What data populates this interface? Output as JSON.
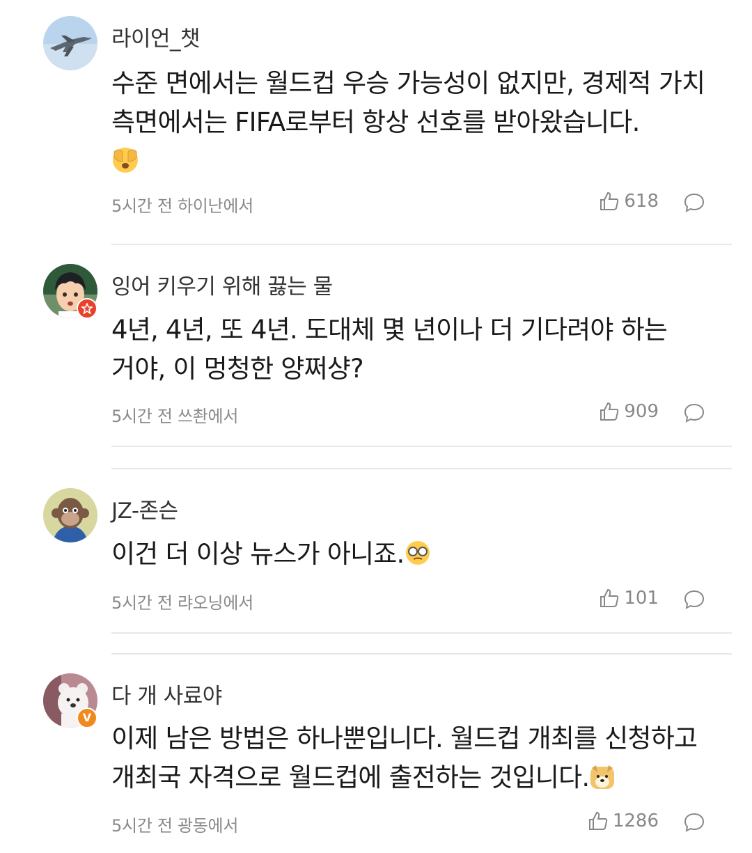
{
  "comments": [
    {
      "username": "라이언_챗",
      "text": "수준 면에서는 월드컵 우승 가능성이 없지만, 경제적 가치 측면에서는 FIFA로부터 항상 선호를 받아왔습니다.",
      "emoji": "face-with-hands-emoji",
      "time": "5시간 전",
      "location": "하이난에서",
      "likes": "618",
      "avatar": "fighter-jet-avatar",
      "badge": null
    },
    {
      "username": "잉어 키우기 위해 끓는 물",
      "text": "4년, 4년, 또 4년. 도대체 몇 년이나 더 기다려야 하는 거야, 이 멍청한 양쩌샹?",
      "emoji": null,
      "time": "5시간 전",
      "location": "쓰촨에서",
      "likes": "909",
      "avatar": "anime-boy-avatar",
      "badge": "red-star-badge"
    },
    {
      "username": "JZ-존슨",
      "text": "이건 더 이상 뉴스가 아니죠.",
      "emoji": "glasses-face-emoji",
      "time": "5시간 전",
      "location": "랴오닝에서",
      "likes": "101",
      "avatar": "ape-avatar",
      "badge": null
    },
    {
      "username": "다 개 사료야",
      "text": "이제 남은 방법은 하나뿐입니다. 월드컵 개최를 신청하고 개최국 자격으로 월드컵에 출전하는 것입니다.",
      "emoji": "doge-emoji",
      "time": "5시간 전",
      "location": "광동에서",
      "likes": "1286",
      "avatar": "bear-avatar",
      "badge": "orange-v-badge"
    }
  ],
  "colors": {
    "badge_red": "#e8412c",
    "badge_orange": "#f08a1d",
    "meta_gray": "#8a8a8a",
    "divider": "#e8e8e8"
  }
}
